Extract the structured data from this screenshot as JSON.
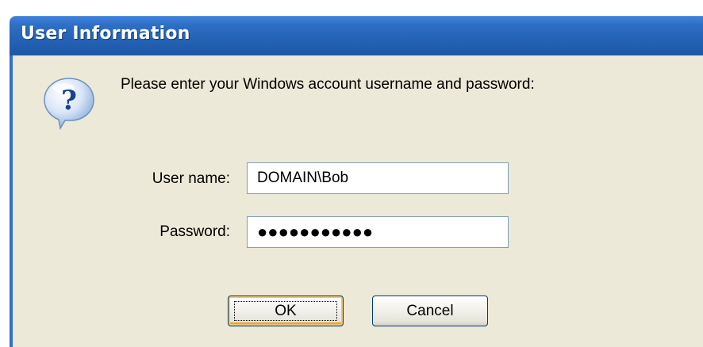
{
  "dialog": {
    "title": "User Information",
    "icon": "question-icon",
    "prompt": "Please enter your Windows account username and password:",
    "fields": {
      "username_label": "User name:",
      "username_value": "DOMAIN\\Bob",
      "password_label": "Password:",
      "password_value": "●●●●●●●●●●●"
    },
    "buttons": {
      "ok_label": "OK",
      "cancel_label": "Cancel"
    }
  },
  "colors": {
    "titlebar": "#2563b7",
    "client_background": "#ece9d8",
    "field_border": "#7f9db9",
    "button_border": "#003c74",
    "default_button_highlight": "#f0c66d"
  }
}
